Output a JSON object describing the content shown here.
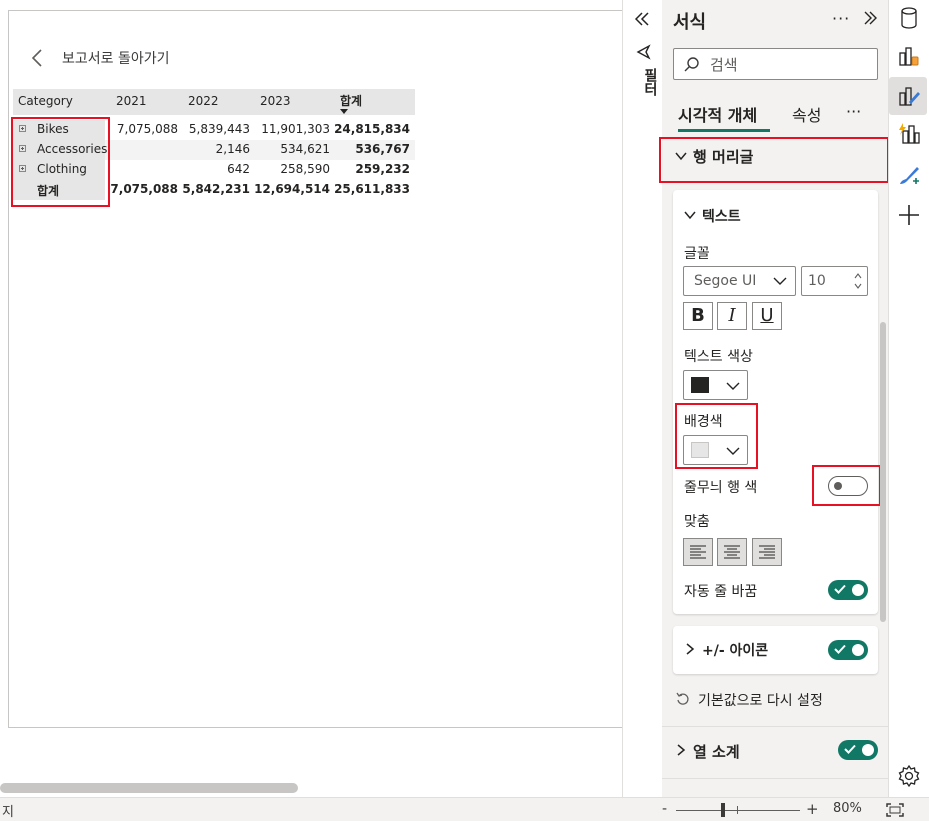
{
  "canvas": {
    "back_label": "보고서로 돌아가기",
    "matrix": {
      "columns": [
        "Category",
        "2021",
        "2022",
        "2023",
        "합계"
      ],
      "rows": [
        {
          "label": "Bikes",
          "values": [
            "7,075,088",
            "5,839,443",
            "11,901,303",
            "24,815,834"
          ]
        },
        {
          "label": "Accessories",
          "values": [
            "",
            "2,146",
            "534,621",
            "536,767"
          ]
        },
        {
          "label": "Clothing",
          "values": [
            "",
            "642",
            "258,590",
            "259,232"
          ]
        },
        {
          "label": "합계",
          "values": [
            "7,075,088",
            "5,842,231",
            "12,694,514",
            "25,611,833"
          ]
        }
      ]
    }
  },
  "filter_strip": {
    "label": "필터"
  },
  "format_pane": {
    "title": "서식",
    "more": "···",
    "search_placeholder": "검색",
    "tabs": [
      "시각적 개체",
      "속성"
    ],
    "tab_more": "···",
    "row_header_section": "행 머리글",
    "text_section": "텍스트",
    "font_label": "글꼴",
    "font_family_value": "Segoe UI",
    "font_size_value": "10",
    "bold_label": "B",
    "italic_label": "I",
    "underline_label": "U",
    "text_color_label": "텍스트 색상",
    "text_color": "#252423",
    "bg_color_label": "배경색",
    "bg_color": "#e6e6e6",
    "banded_label": "줄무늬 행 색",
    "banded_on": false,
    "alignment_label": "맞춤",
    "word_wrap_label": "자동 줄 바꿈",
    "word_wrap_on": true,
    "plus_minus_section": "+/- 아이콘",
    "plus_minus_on": true,
    "reset_label": "기본값으로 다시 설정",
    "subtotals_section": "열 소계",
    "subtotals_on": true
  },
  "status_bar": {
    "left_text": "지",
    "zoom_minus": "-",
    "zoom_plus": "+",
    "zoom_level": "80%"
  },
  "colors": {
    "accent": "#117865",
    "highlight_box": "#e81123"
  }
}
